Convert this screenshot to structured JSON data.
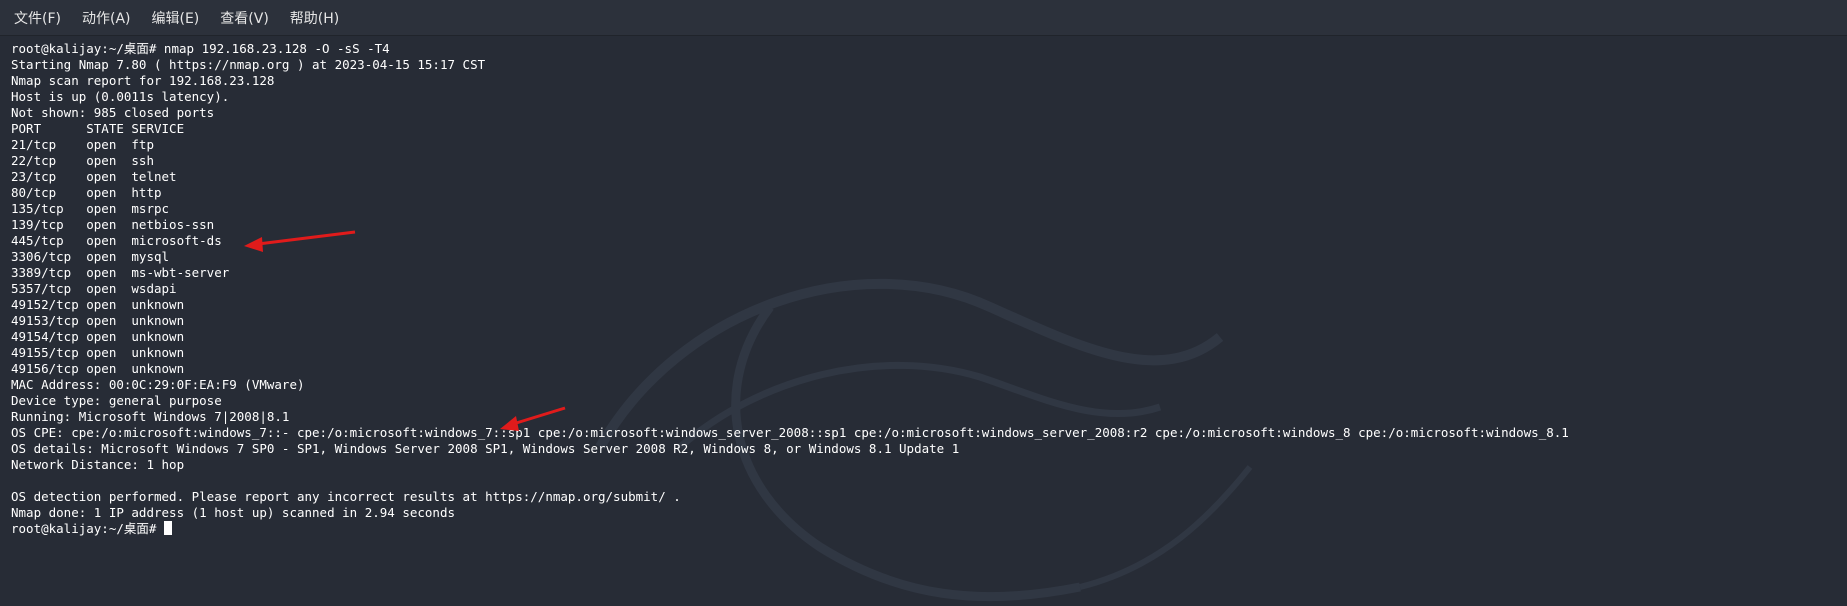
{
  "menu": {
    "items": [
      "文件(F)",
      "动作(A)",
      "编辑(E)",
      "查看(V)",
      "帮助(H)"
    ]
  },
  "terminal": {
    "lines": [
      "root@kalijay:~/桌面# nmap 192.168.23.128 -O -sS -T4",
      "Starting Nmap 7.80 ( https://nmap.org ) at 2023-04-15 15:17 CST",
      "Nmap scan report for 192.168.23.128",
      "Host is up (0.0011s latency).",
      "Not shown: 985 closed ports",
      "PORT      STATE SERVICE",
      "21/tcp    open  ftp",
      "22/tcp    open  ssh",
      "23/tcp    open  telnet",
      "80/tcp    open  http",
      "135/tcp   open  msrpc",
      "139/tcp   open  netbios-ssn",
      "445/tcp   open  microsoft-ds",
      "3306/tcp  open  mysql",
      "3389/tcp  open  ms-wbt-server",
      "5357/tcp  open  wsdapi",
      "49152/tcp open  unknown",
      "49153/tcp open  unknown",
      "49154/tcp open  unknown",
      "49155/tcp open  unknown",
      "49156/tcp open  unknown",
      "MAC Address: 00:0C:29:0F:EA:F9 (VMware)",
      "Device type: general purpose",
      "Running: Microsoft Windows 7|2008|8.1",
      "OS CPE: cpe:/o:microsoft:windows_7::- cpe:/o:microsoft:windows_7::sp1 cpe:/o:microsoft:windows_server_2008::sp1 cpe:/o:microsoft:windows_server_2008:r2 cpe:/o:microsoft:windows_8 cpe:/o:microsoft:windows_8.1",
      "OS details: Microsoft Windows 7 SP0 - SP1, Windows Server 2008 SP1, Windows Server 2008 R2, Windows 8, or Windows 8.1 Update 1",
      "Network Distance: 1 hop",
      "",
      "OS detection performed. Please report any incorrect results at https://nmap.org/submit/ .",
      "Nmap done: 1 IP address (1 host up) scanned in 2.94 seconds"
    ],
    "prompt": "root@kalijay:~/桌面# "
  },
  "colors": {
    "background": "#272c36",
    "menubar": "#2c313b",
    "text": "#ffffff",
    "annotation_arrow": "#e01b1b"
  },
  "icons": [
    "kali-dragon-watermark-icon",
    "annotation-arrow-icon"
  ]
}
